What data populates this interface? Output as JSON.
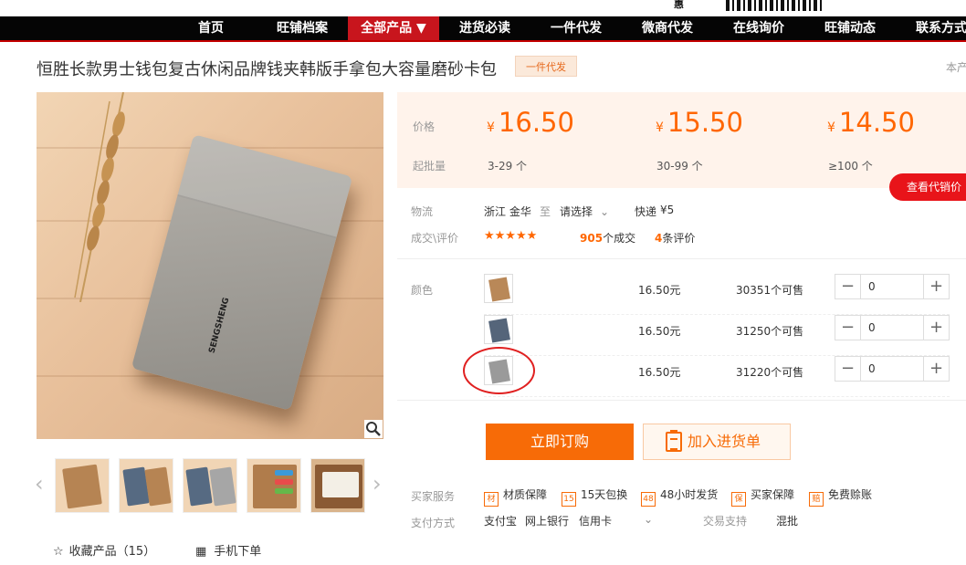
{
  "top_strip": {
    "hint": "惠"
  },
  "nav": {
    "items": [
      {
        "label": "首页"
      },
      {
        "label": "旺铺档案"
      },
      {
        "label": "全部产品 ▼",
        "active": true
      },
      {
        "label": "进货必读"
      },
      {
        "label": "一件代发"
      },
      {
        "label": "微商代发"
      },
      {
        "label": "在线询价"
      },
      {
        "label": "旺铺动态"
      },
      {
        "label": "联系方式"
      }
    ]
  },
  "product": {
    "title": "恒胜长款男士钱包复古休闲品牌钱夹韩版手拿包大容量磨砂卡包",
    "tag": "一件代发",
    "corner": "本产"
  },
  "images": {
    "wallet_logo": "SENGSHENG",
    "thumbnails": [
      "brown-wallet",
      "blue-brown-wallets",
      "blue-gray-wallets",
      "open-wallet-cards",
      "open-wallet-notes"
    ]
  },
  "pricing": {
    "price_label": "价格",
    "qty_label": "起批量",
    "currency": "¥",
    "tiers": [
      {
        "price": "16.50",
        "range": "3-29 个"
      },
      {
        "price": "15.50",
        "range": "30-99 个"
      },
      {
        "price": "14.50",
        "range": "≥100 个"
      }
    ],
    "agent_button": "查看代销价"
  },
  "logistics": {
    "label": "物流",
    "origin": "浙江 金华",
    "to": "至",
    "select": "请选择",
    "express": "快递",
    "fee": "¥5"
  },
  "deals": {
    "label": "成交\\评价",
    "stars": "★★★★★",
    "orders_count": "905",
    "orders_text": "个成交",
    "reviews_count": "4",
    "reviews_text": "条评价"
  },
  "colors": {
    "label": "颜色",
    "items": [
      {
        "price": "16.50元",
        "stock": "30351个可售",
        "qty": "0",
        "swatch": "#b98858"
      },
      {
        "price": "16.50元",
        "stock": "31250个可售",
        "qty": "0",
        "swatch": "#55657a"
      },
      {
        "price": "16.50元",
        "stock": "31220个可售",
        "qty": "0",
        "swatch": "#9a9a9a"
      }
    ]
  },
  "actions": {
    "buy": "立即订购",
    "cart": "加入进货单"
  },
  "services": {
    "label": "买家服务",
    "items": [
      {
        "icon": "材",
        "text": "材质保障"
      },
      {
        "icon": "15",
        "text": "15天包换"
      },
      {
        "icon": "48",
        "text": "48小时发货"
      },
      {
        "icon": "保",
        "text": "买家保障"
      },
      {
        "icon": "赔",
        "text": "免费赊账"
      }
    ]
  },
  "payment": {
    "label": "支付方式",
    "methods": [
      "支付宝",
      "网上银行",
      "信用卡"
    ],
    "trade_label": "交易支持",
    "trade_value": "混批"
  },
  "footer": {
    "favorite": "收藏产品（15）",
    "mobile": "手机下单"
  }
}
